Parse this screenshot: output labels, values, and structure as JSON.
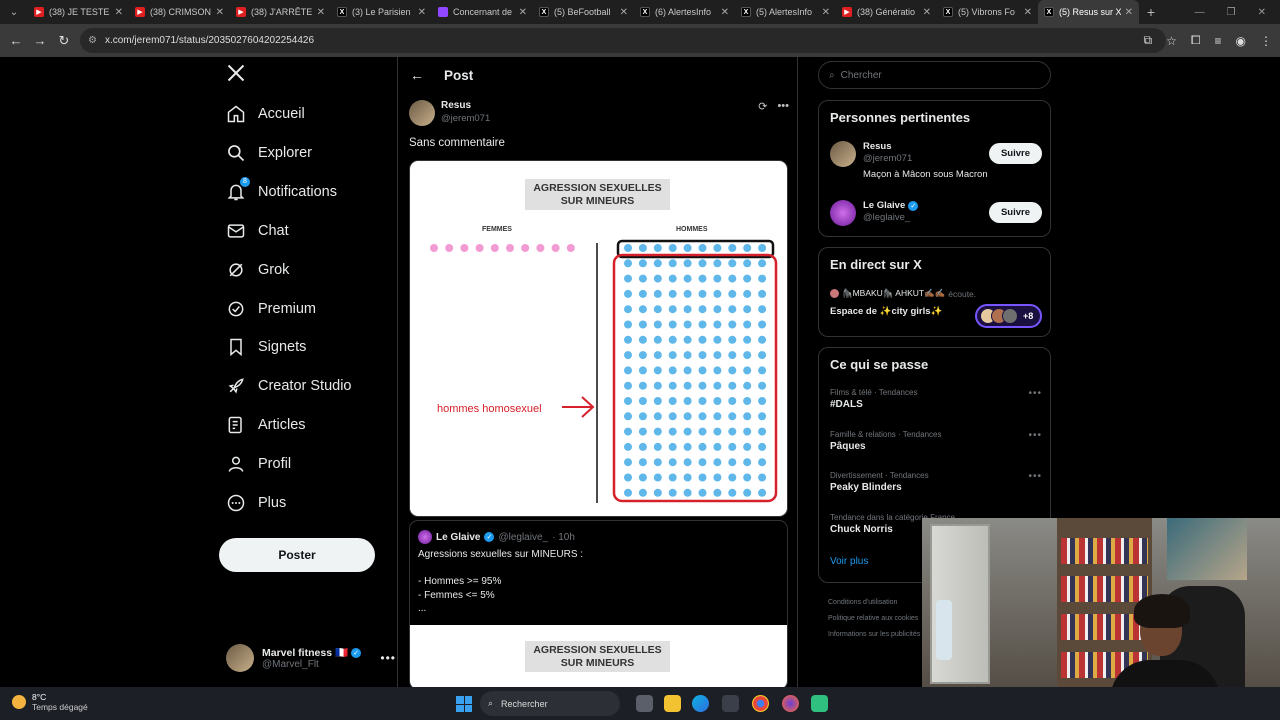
{
  "browser": {
    "tabs": [
      {
        "title": "(38) JE TESTE L",
        "icon": "youtube-icon"
      },
      {
        "title": "(38) CRIMSON",
        "icon": "youtube-icon"
      },
      {
        "title": "(38) J'ARRÊTE T",
        "icon": "youtube-icon"
      },
      {
        "title": "(3) Le Parisien",
        "icon": "x-icon"
      },
      {
        "title": "Concernant de",
        "icon": "twitch-icon"
      },
      {
        "title": "(5) BeFootball",
        "icon": "x-icon"
      },
      {
        "title": "(6) AlertesInfo",
        "icon": "x-icon"
      },
      {
        "title": "(5) AlertesInfo",
        "icon": "x-icon"
      },
      {
        "title": "(38) Génératio",
        "icon": "youtube-icon"
      },
      {
        "title": "(5) Vibrons Fo",
        "icon": "x-icon"
      },
      {
        "title": "(5) Resus sur X",
        "icon": "x-icon"
      }
    ],
    "active_tab_index": 10,
    "url": "x.com/jerem071/status/2035027604202254426"
  },
  "nav": {
    "items": [
      {
        "label": "Accueil",
        "icon": "home-icon"
      },
      {
        "label": "Explorer",
        "icon": "search-icon"
      },
      {
        "label": "Notifications",
        "icon": "bell-icon",
        "badge": "8"
      },
      {
        "label": "Chat",
        "icon": "mail-icon"
      },
      {
        "label": "Grok",
        "icon": "grok-icon"
      },
      {
        "label": "Premium",
        "icon": "verified-badge-icon"
      },
      {
        "label": "Signets",
        "icon": "bookmark-icon"
      },
      {
        "label": "Creator Studio",
        "icon": "rocket-icon"
      },
      {
        "label": "Articles",
        "icon": "article-icon"
      },
      {
        "label": "Profil",
        "icon": "person-icon"
      },
      {
        "label": "Plus",
        "icon": "more-circle-icon"
      }
    ],
    "post_button": "Poster",
    "account": {
      "name": "Marvel fitness 🇫🇷",
      "handle": "@Marvel_Flt"
    }
  },
  "post": {
    "header_title": "Post",
    "author_name": "Resus",
    "author_handle": "@jerem071",
    "text": "Sans commentaire",
    "image": {
      "title_line1": "AGRESSION SEXUELLES",
      "title_line2": "SUR MINEURS",
      "label_women": "FEMMES",
      "label_men": "HOMMES",
      "annotation": "hommes homosexuel",
      "women_dots": 10,
      "men_dots_cols": 10,
      "men_dots_rows": 17
    },
    "quote": {
      "author_name": "Le Glaive",
      "author_handle": "@leglaive_",
      "time": "· 10h",
      "body": "Agressions sexuelles sur MINEURS :\n\n- Hommes >= 95%\n- Femmes <= 5%\n...",
      "image_title_line1": "AGRESSION SEXUELLES",
      "image_title_line2": "SUR MINEURS"
    }
  },
  "sidebar": {
    "search_placeholder": "Chercher",
    "relevant": {
      "title": "Personnes pertinentes",
      "people": [
        {
          "name": "Resus",
          "handle": "@jerem071",
          "bio": "Maçon à Mâcon sous Macron",
          "button": "Suivre",
          "verified": false
        },
        {
          "name": "Le Glaive",
          "handle": "@leglaive_",
          "bio": "",
          "button": "Suivre",
          "verified": true
        }
      ]
    },
    "live": {
      "title": "En direct sur X",
      "host": "🦍MBAKU🦍 AHKUT✍🏾✍🏾",
      "listening": "écoute.",
      "space_title": "Espace de ✨city girls✨",
      "extra_count": "+8"
    },
    "trends": {
      "title": "Ce qui se passe",
      "items": [
        {
          "category": "Films & télé · Tendances",
          "name": "#DALS"
        },
        {
          "category": "Famille & relations · Tendances",
          "name": "Pâques"
        },
        {
          "category": "Divertissement · Tendances",
          "name": "Peaky Blinders"
        },
        {
          "category": "Tendance dans la catégorie France",
          "name": "Chuck Norris"
        }
      ],
      "more": "Voir plus"
    },
    "footer": [
      "Conditions d'utilisation",
      "Politique relative aux cookies",
      "Informations sur les publicités"
    ]
  },
  "taskbar": {
    "temperature": "8°C",
    "weather": "Temps dégagé",
    "search": "Rechercher"
  }
}
